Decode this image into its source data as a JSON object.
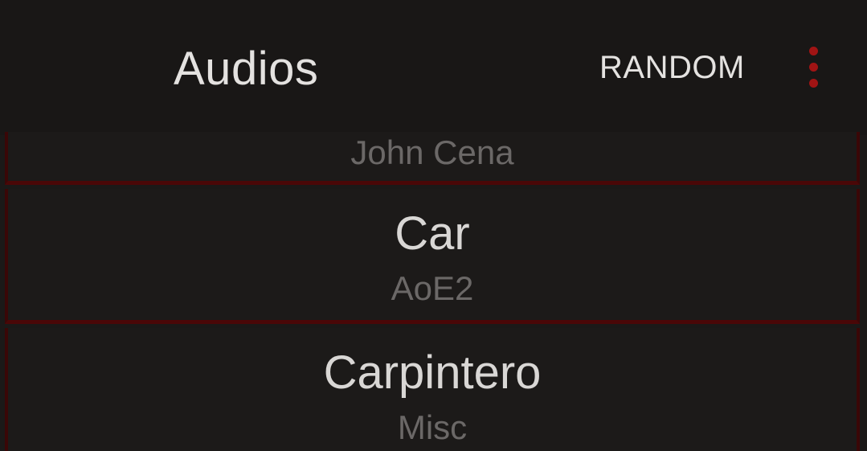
{
  "toolbar": {
    "title": "Audios",
    "random_label": "RANDOM",
    "menu_icon": "more-vert-icon"
  },
  "colors": {
    "accent": "#a11414",
    "background": "#1b1918",
    "divider": "#4a0707"
  },
  "items": [
    {
      "title": "",
      "subtitle": "John Cena"
    },
    {
      "title": "Car",
      "subtitle": "AoE2"
    },
    {
      "title": "Carpintero",
      "subtitle": "Misc"
    }
  ]
}
